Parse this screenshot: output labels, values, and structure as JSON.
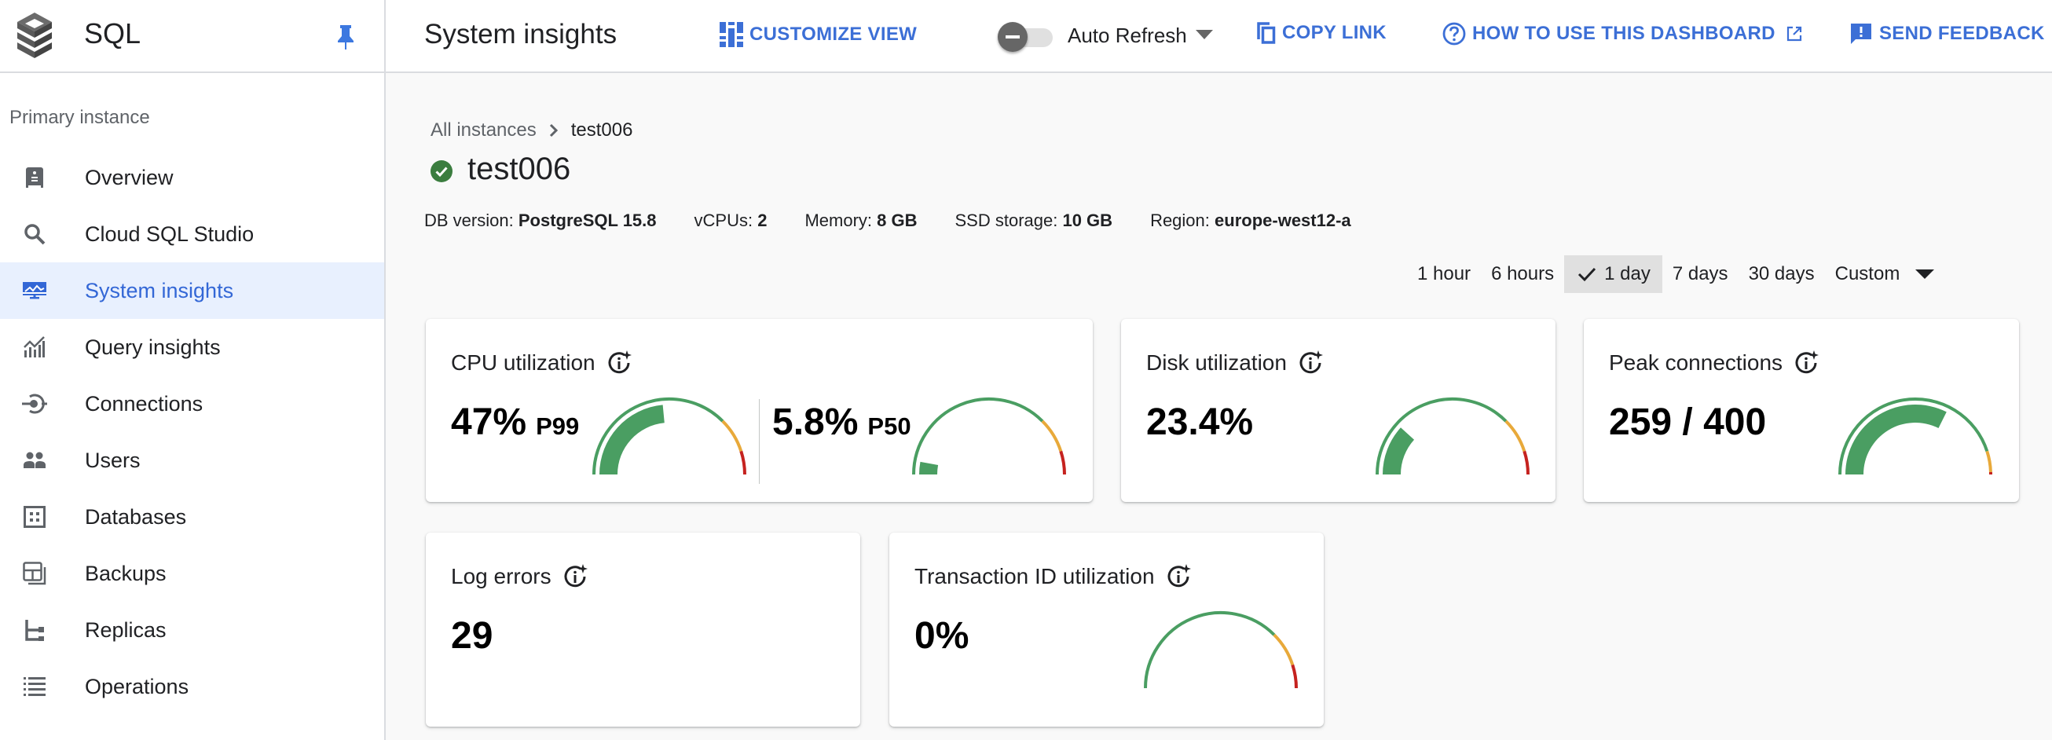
{
  "sidebar": {
    "product_name": "SQL",
    "logo_icon": "stacked-layers-logo",
    "pin_icon": "pin-icon",
    "section_label": "Primary instance",
    "items": [
      {
        "label": "Overview",
        "icon": "overview-icon",
        "active": false
      },
      {
        "label": "Cloud SQL Studio",
        "icon": "search-icon",
        "active": false
      },
      {
        "label": "System insights",
        "icon": "monitor-icon",
        "active": true
      },
      {
        "label": "Query insights",
        "icon": "query-insights-icon",
        "active": false
      },
      {
        "label": "Connections",
        "icon": "connections-icon",
        "active": false
      },
      {
        "label": "Users",
        "icon": "users-icon",
        "active": false
      },
      {
        "label": "Databases",
        "icon": "databases-icon",
        "active": false
      },
      {
        "label": "Backups",
        "icon": "backups-icon",
        "active": false
      },
      {
        "label": "Replicas",
        "icon": "replicas-icon",
        "active": false
      },
      {
        "label": "Operations",
        "icon": "list-icon",
        "active": false
      }
    ]
  },
  "header": {
    "title": "System insights",
    "customize_view": "CUSTOMIZE VIEW",
    "auto_refresh": {
      "label": "Auto Refresh",
      "enabled": false
    },
    "copy_link": "COPY LINK",
    "how_to_use": "HOW TO USE THIS DASHBOARD",
    "send_feedback": "SEND FEEDBACK"
  },
  "breadcrumb": {
    "parent": "All instances",
    "current": "test006"
  },
  "instance": {
    "name": "test006",
    "status": "running",
    "specs": [
      {
        "label": "DB version:",
        "value": "PostgreSQL 15.8"
      },
      {
        "label": "vCPUs:",
        "value": "2"
      },
      {
        "label": "Memory:",
        "value": "8 GB"
      },
      {
        "label": "SSD storage:",
        "value": "10 GB"
      },
      {
        "label": "Region:",
        "value": "europe-west12-a"
      }
    ]
  },
  "time_range": {
    "options": [
      "1 hour",
      "6 hours",
      "1 day",
      "7 days",
      "30 days",
      "Custom"
    ],
    "selected": "1 day"
  },
  "colors": {
    "accent": "#3c6fd6",
    "gauge_green": "#4a9e62",
    "gauge_yellow": "#e8a93a",
    "gauge_red": "#c5221f",
    "status_ok": "#3b7d3f"
  },
  "cards": {
    "cpu": {
      "title": "CPU utilization",
      "p99": {
        "value": "47%",
        "label": "P99",
        "fraction": 0.47
      },
      "p50": {
        "value": "5.8%",
        "label": "P50",
        "fraction": 0.058
      }
    },
    "disk": {
      "title": "Disk utilization",
      "value": "23.4%",
      "fraction": 0.234
    },
    "connections": {
      "title": "Peak connections",
      "value": "259 / 400",
      "fraction": 0.6475
    },
    "log_errors": {
      "title": "Log errors",
      "value": "29"
    },
    "txid": {
      "title": "Transaction ID utilization",
      "value": "0%",
      "fraction": 0.0
    }
  },
  "gauge_thresholds": {
    "default": {
      "yellow_start": 0.75,
      "red_start": 0.9
    },
    "connections": {
      "yellow_start": 0.9,
      "red_start": 0.99
    }
  }
}
